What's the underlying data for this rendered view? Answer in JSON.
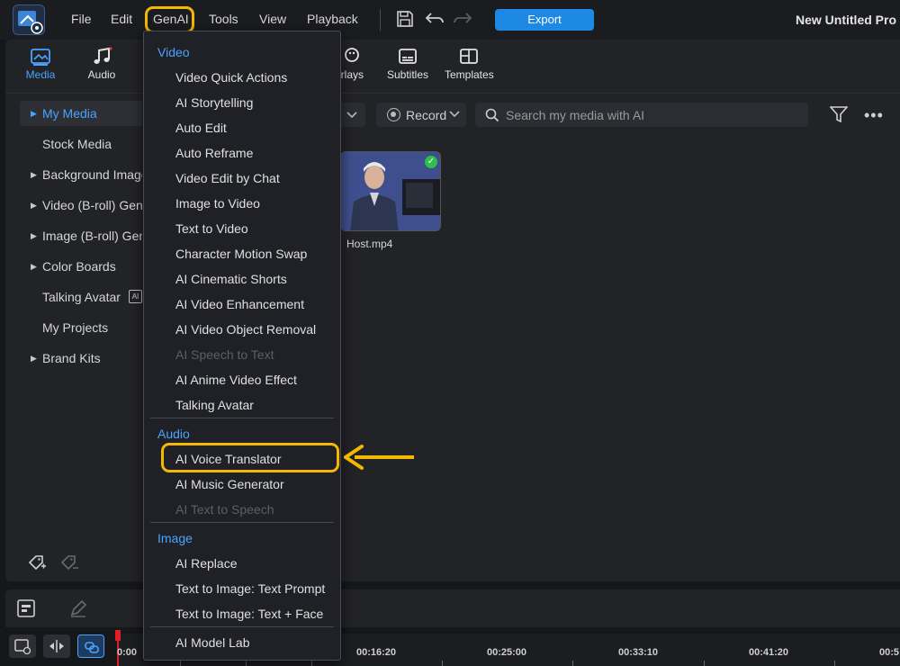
{
  "menubar": {
    "items": [
      "File",
      "Edit",
      "GenAI",
      "Tools",
      "View",
      "Playback"
    ],
    "export_label": "Export",
    "project_title": "New Untitled Pro"
  },
  "category_tabs": [
    {
      "label": "Media",
      "icon": "media-icon",
      "active": true
    },
    {
      "label": "Audio",
      "icon": "music-note-icon",
      "active": false
    },
    {
      "label": "erlays",
      "icon": "overlays-icon",
      "active": false
    },
    {
      "label": "Subtitles",
      "icon": "subtitles-icon",
      "active": false
    },
    {
      "label": "Templates",
      "icon": "templates-icon",
      "active": false
    }
  ],
  "sidebar": {
    "items": [
      {
        "label": "My Media",
        "expandable": true,
        "active": true
      },
      {
        "label": "Stock Media",
        "expandable": false,
        "active": false
      },
      {
        "label": "Background Image",
        "expandable": true,
        "active": false
      },
      {
        "label": "Video (B-roll) Gene",
        "expandable": true,
        "active": false
      },
      {
        "label": "Image (B-roll) Gen",
        "expandable": true,
        "active": false
      },
      {
        "label": "Color Boards",
        "expandable": true,
        "active": false
      },
      {
        "label": "Talking Avatar",
        "expandable": false,
        "active": false
      },
      {
        "label": "My Projects",
        "expandable": false,
        "active": false
      },
      {
        "label": "Brand Kits",
        "expandable": true,
        "active": false
      }
    ],
    "ai_badge": "AI"
  },
  "media_toolbar": {
    "record_label": "Record",
    "search_placeholder": "Search my media with AI"
  },
  "media": {
    "items": [
      {
        "name": "Host.mp4",
        "status": "check-icon"
      }
    ]
  },
  "timeline": {
    "times": [
      "0:00",
      "00:16:20",
      "00:25:00",
      "00:33:10",
      "00:41:20",
      "00:5"
    ]
  },
  "genai_menu": {
    "sections": [
      {
        "title": "Video",
        "items": [
          {
            "label": "Video Quick Actions",
            "enabled": true
          },
          {
            "label": "AI Storytelling",
            "enabled": true
          },
          {
            "label": "Auto Edit",
            "enabled": true
          },
          {
            "label": "Auto Reframe",
            "enabled": true
          },
          {
            "label": "Video Edit by Chat",
            "enabled": true
          },
          {
            "label": "Image to Video",
            "enabled": true
          },
          {
            "label": "Text to Video",
            "enabled": true
          },
          {
            "label": "Character Motion Swap",
            "enabled": true
          },
          {
            "label": "AI Cinematic Shorts",
            "enabled": true
          },
          {
            "label": "AI Video Enhancement",
            "enabled": true
          },
          {
            "label": "AI Video Object Removal",
            "enabled": true
          },
          {
            "label": "AI Speech to Text",
            "enabled": false
          },
          {
            "label": "AI Anime Video Effect",
            "enabled": true
          },
          {
            "label": "Talking Avatar",
            "enabled": true
          }
        ]
      },
      {
        "title": "Audio",
        "items": [
          {
            "label": "AI Voice Translator",
            "enabled": true,
            "highlighted": true
          },
          {
            "label": "AI Music Generator",
            "enabled": true
          },
          {
            "label": "AI Text to Speech",
            "enabled": false
          }
        ]
      },
      {
        "title": "Image",
        "items": [
          {
            "label": "AI Replace",
            "enabled": true
          },
          {
            "label": "Text to Image: Text Prompt",
            "enabled": true
          },
          {
            "label": "Text to Image: Text + Face",
            "enabled": true
          }
        ]
      }
    ],
    "footer_item": "AI Model Lab"
  },
  "colors": {
    "accent": "#1e88e5",
    "highlight": "#f5b800",
    "section_title": "#4aa3ff",
    "playhead": "#e02020"
  }
}
